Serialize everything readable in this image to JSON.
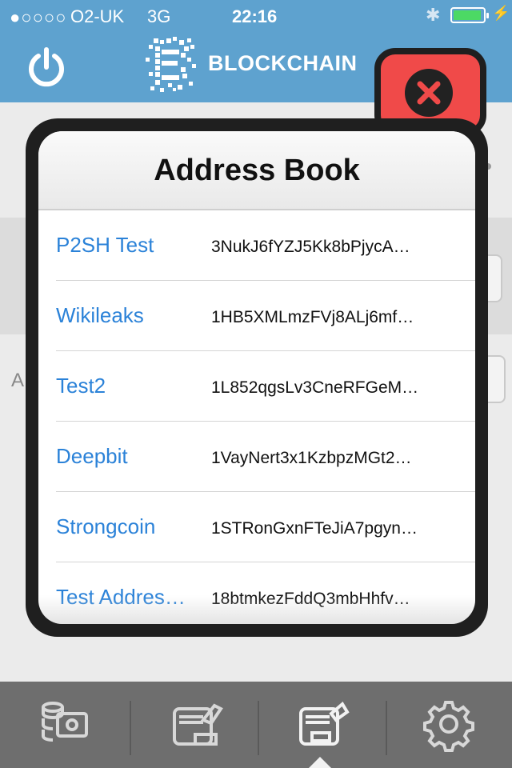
{
  "status_bar": {
    "signal": "●○○○○",
    "carrier": "O2-UK",
    "network": "3G",
    "time": "22:16",
    "bluetooth_icon": "bluetooth-icon",
    "battery_icon": "battery-icon"
  },
  "header": {
    "brand": "BLOCKCHAIN",
    "power_icon": "power-icon",
    "logo_icon": "blockchain-logo"
  },
  "background": {
    "partial_label": "A"
  },
  "modal": {
    "title": "Address Book",
    "close_icon": "close-icon",
    "entries": [
      {
        "label": "P2SH Test",
        "address": "3NukJ6fYZJ5Kk8bPjycA…"
      },
      {
        "label": "Wikileaks",
        "address": "1HB5XMLmzFVj8ALj6mf…"
      },
      {
        "label": "Test2",
        "address": "1L852qgsLv3CneRFGeM…"
      },
      {
        "label": "Deepbit",
        "address": "1VayNert3x1KzbpzMGt2…"
      },
      {
        "label": "Strongcoin",
        "address": "1STRonGxnFTeJiA7pgyn…"
      },
      {
        "label": "Test Addres…",
        "address": "18btmkezFddQ3mbHhfv…"
      }
    ]
  },
  "tabbar": {
    "tabs": [
      {
        "name": "transactions-icon"
      },
      {
        "name": "send-icon"
      },
      {
        "name": "receive-icon",
        "selected": true
      },
      {
        "name": "settings-icon"
      }
    ]
  },
  "colors": {
    "header_bg": "#5ea2cf",
    "close_red": "#f04a49",
    "link_blue": "#2b82d8",
    "tabbar_bg": "#6e6e6e"
  }
}
